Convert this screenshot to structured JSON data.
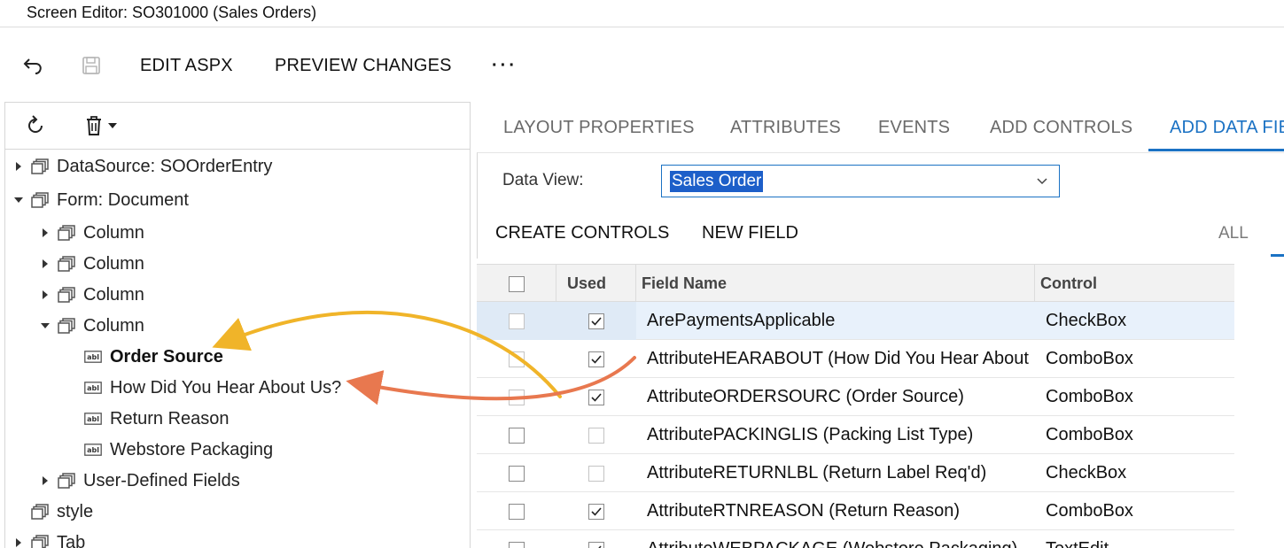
{
  "window": {
    "title": "Screen Editor: SO301000 (Sales Orders)"
  },
  "toolbar": {
    "undo_icon": "undo-icon",
    "save_icon": "save-icon",
    "edit_aspx": "EDIT ASPX",
    "preview_changes": "PREVIEW CHANGES",
    "more": "···"
  },
  "left_toolbar": {
    "refresh_icon": "refresh-icon",
    "delete_icon": "trash-icon",
    "dropdown_icon": "caret-down-icon"
  },
  "tree": {
    "datasource": "DataSource: SOOrderEntry",
    "form": "Form: Document",
    "column1": "Column",
    "column2": "Column",
    "column3": "Column",
    "column4": "Column",
    "order_source": "Order Source",
    "how_did_you_hear": "How Did You Hear About Us?",
    "return_reason": "Return Reason",
    "webstore_packaging": "Webstore Packaging",
    "user_defined_fields": "User-Defined Fields",
    "style": "style",
    "tab": "Tab"
  },
  "tabs": {
    "layout_properties": "LAYOUT PROPERTIES",
    "attributes": "ATTRIBUTES",
    "events": "EVENTS",
    "add_controls": "ADD CONTROLS",
    "add_data_fields": "ADD DATA FIE",
    "active": "ADD DATA FIE"
  },
  "data_view": {
    "label": "Data View:",
    "value": "Sales Order"
  },
  "actions": {
    "create_controls": "CREATE CONTROLS",
    "new_field": "NEW FIELD",
    "filter_all": "ALL"
  },
  "grid": {
    "headers": {
      "used": "Used",
      "field_name": "Field Name",
      "control": "Control"
    },
    "rows": [
      {
        "selected": false,
        "used": true,
        "field_name": "ArePaymentsApplicable",
        "control": "CheckBox"
      },
      {
        "selected": false,
        "used": true,
        "field_name": "AttributeHEARABOUT (How Did You Hear About U",
        "control": "ComboBox"
      },
      {
        "selected": false,
        "used": true,
        "field_name": "AttributeORDERSOURC (Order Source)",
        "control": "ComboBox"
      },
      {
        "selected": false,
        "used": false,
        "field_name": "AttributePACKINGLIS (Packing List Type)",
        "control": "ComboBox"
      },
      {
        "selected": false,
        "used": false,
        "field_name": "AttributeRETURNLBL (Return Label Req'd)",
        "control": "CheckBox"
      },
      {
        "selected": false,
        "used": true,
        "field_name": "AttributeRTNREASON (Return Reason)",
        "control": "ComboBox"
      },
      {
        "selected": false,
        "used": true,
        "field_name": "AttributeWEBPACKAGE (Webstore Packaging)",
        "control": "TextEdit"
      }
    ]
  },
  "colors": {
    "accent": "#1b72c4",
    "arrow_yellow": "#f0b429",
    "arrow_orange": "#e8784f"
  }
}
